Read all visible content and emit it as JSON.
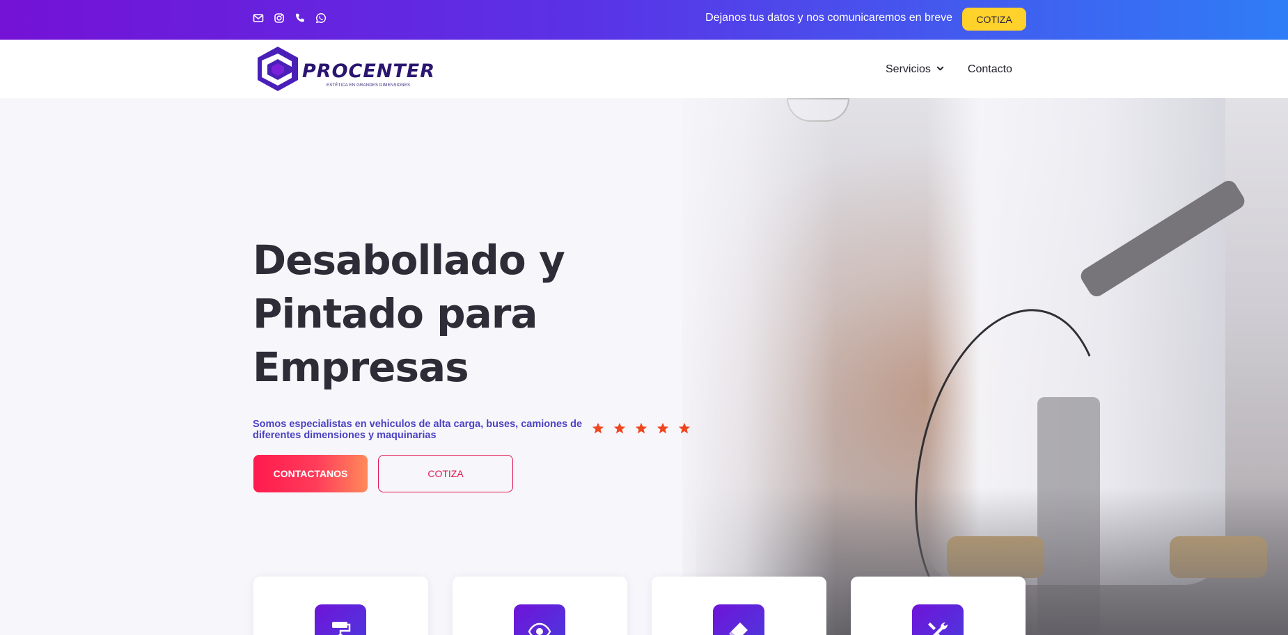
{
  "topbar": {
    "icons": [
      "envelope-icon",
      "instagram-icon",
      "phone-icon",
      "whatsapp-icon"
    ],
    "tagline": "Dejanos tus datos y nos comunicaremos en breve",
    "cta_label": "COTIZA",
    "gradient": [
      "#7412d6",
      "#2f7df6"
    ],
    "cta_color": "#fed12b"
  },
  "navbar": {
    "logo": {
      "wordmark": "PROCENTER",
      "slogan": "ESTÉTICA EN GRANDES DIMENSIONES"
    },
    "links": [
      {
        "label": "Servicios",
        "has_dropdown": true,
        "icon": "chevron-down-icon"
      },
      {
        "label": "Contacto",
        "has_dropdown": false
      }
    ]
  },
  "hero": {
    "title": "Desabollado y Pintado para Empresas",
    "subtitle": "Somos especialistas en vehiculos de alta carga, buses, camiones de diferentes dimensiones y maquinarias",
    "rating_stars": 5,
    "star_color": "#f0461e",
    "primary_button": "CONTACTANOS",
    "secondary_button": "COTIZA",
    "accent_color": "#e2144e"
  },
  "service_cards": [
    {
      "icon": "paint-roller-icon"
    },
    {
      "icon": "eye-icon"
    },
    {
      "icon": "eraser-icon"
    },
    {
      "icon": "tools-icon"
    }
  ]
}
